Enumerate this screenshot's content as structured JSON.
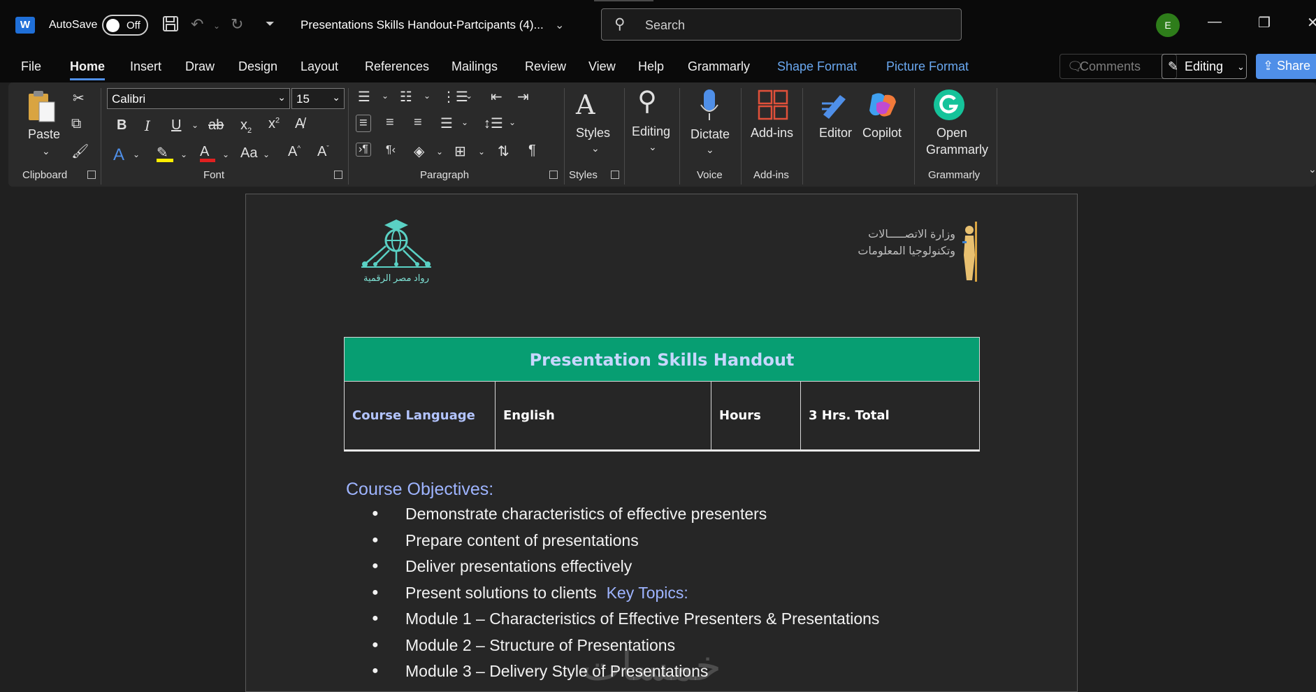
{
  "titlebar": {
    "app_logo": "W",
    "autosave_label": "AutoSave",
    "autosave_state": "Off",
    "doc_title": "Presentations Skills Handout-Partcipants (4)...",
    "search_placeholder": "Search",
    "avatar_initial": "E"
  },
  "menu": {
    "tabs": [
      "File",
      "Home",
      "Insert",
      "Draw",
      "Design",
      "Layout",
      "References",
      "Mailings",
      "Review",
      "View",
      "Help",
      "Grammarly",
      "Shape Format",
      "Picture Format"
    ],
    "active_tab": "Home",
    "comments_label": "Comments",
    "editing_label": "Editing",
    "share_label": "Share"
  },
  "ribbon": {
    "clipboard": {
      "paste_label": "Paste",
      "group_label": "Clipboard"
    },
    "font": {
      "font_name": "Calibri",
      "font_size": "15",
      "group_label": "Font"
    },
    "paragraph": {
      "group_label": "Paragraph"
    },
    "styles": {
      "styles_label": "Styles",
      "group_label": "Styles"
    },
    "editing": {
      "label": "Editing"
    },
    "voice": {
      "dictate_label": "Dictate",
      "group_label": "Voice"
    },
    "addins": {
      "label": "Add-ins",
      "group_label": "Add-ins"
    },
    "editor_label": "Editor",
    "copilot_label": "Copilot",
    "grammarly": {
      "open_label": "Open",
      "open_label2": "Grammarly",
      "group_label": "Grammarly"
    }
  },
  "document": {
    "logo_left_caption": "رواد مصر الرقمية",
    "logo_right_line1": "وزارة الاتصـــــالات",
    "logo_right_line2": "وتكنولوجيا المعلومات",
    "table_title": "Presentation Skills Handout",
    "row": [
      "Course Language",
      "English",
      "Hours",
      "3 Hrs. Total"
    ],
    "objectives_heading": "Course Objectives:",
    "bullets": [
      "Demonstrate characteristics of effective presenters",
      "Prepare content of presentations",
      "Deliver presentations effectively",
      "Present solutions to clients",
      "Module 1 – Characteristics of Effective Presenters & Presentations",
      "Module 2 – Structure of Presentations",
      "Module 3 – Delivery Style of Presentations"
    ],
    "key_topics_heading": "Key Topics:",
    "watermark": "خمسات"
  },
  "colors": {
    "table_header_bg": "#079e72",
    "heading_blue": "#9eb4ff",
    "accent_blue": "#4f8fe8",
    "avatar_green": "#2e7d1a"
  }
}
